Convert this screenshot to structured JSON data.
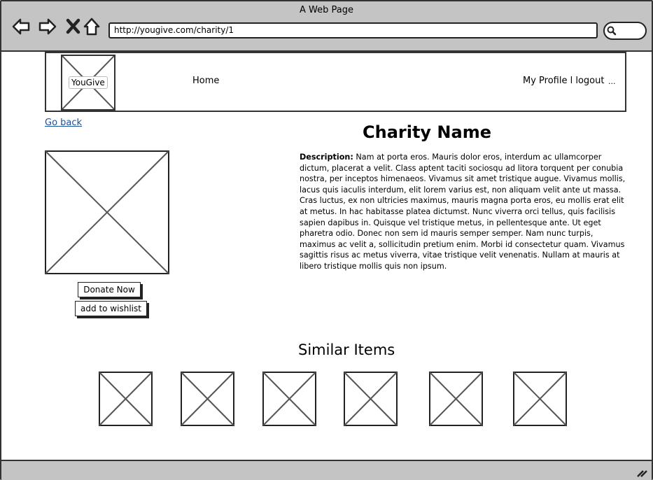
{
  "window": {
    "title": "A Web Page"
  },
  "browser": {
    "url": "http://yougive.com/charity/1",
    "icons": [
      "back-arrow-icon",
      "forward-arrow-icon",
      "close-x-icon",
      "home-icon",
      "search-icon"
    ]
  },
  "header": {
    "logo_text": "YouGive",
    "nav_home": "Home",
    "nav_profile": "My Profile l logout",
    "nav_more": "..."
  },
  "page": {
    "go_back": "Go back",
    "charity_name": "Charity Name",
    "description_label": "Description:",
    "description_text": " Nam at porta eros. Mauris dolor eros, interdum ac ullamcorper dictum, placerat a velit. Class aptent taciti sociosqu ad litora torquent per conubia nostra, per inceptos himenaeos. Vivamus sit amet tristique augue. Vivamus mollis, lacus quis iaculis interdum, elit lorem varius est, non aliquam velit ante ut massa. Cras luctus, ex non ultricies maximus, mauris magna porta eros, eu mollis erat elit at metus. In hac habitasse platea dictumst. Nunc viverra orci tellus, quis facilisis sapien dapibus in. Quisque vel tristique metus, in pellentesque ante. Ut eget pharetra odio. Donec non sem id mauris semper semper. Nam nunc turpis, maximus ac velit a, sollicitudin pretium enim. Morbi id consectetur quam. Vivamus sagittis risus ac metus viverra, vitae tristique velit venenatis. Nullam at mauris at libero tristique mollis quis non ipsum.",
    "donate_button": "Donate Now",
    "wishlist_button": "add to wishlist",
    "similar_title": "Similar Items",
    "similar_items_count": 6
  },
  "colors": {
    "chrome_gray": "#c4c4c4",
    "link_blue": "#1a4f9c",
    "outline": "#333333"
  }
}
